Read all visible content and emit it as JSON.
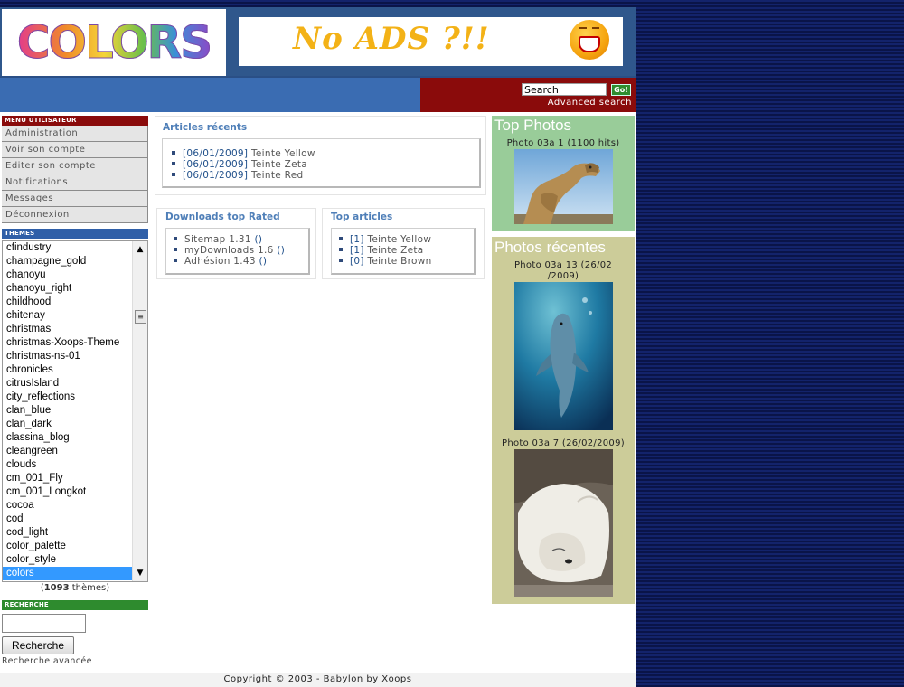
{
  "header": {
    "logo_text": "COLORS",
    "banner_text": "No ADS ?!!",
    "search": {
      "value": "Search",
      "go_label": "Go!",
      "advanced_link": "Advanced search"
    }
  },
  "user_menu": {
    "title": "MENU UTILISATEUR",
    "items": [
      "Administration",
      "Voir son compte",
      "Editer son compte",
      "Notifications",
      "Messages",
      "Déconnexion"
    ]
  },
  "themes": {
    "title": "THEMES",
    "options": [
      "cfindustry",
      "champagne_gold",
      "chanoyu",
      "chanoyu_right",
      "childhood",
      "chitenay",
      "christmas",
      "christmas-Xoops-Theme",
      "christmas-ns-01",
      "chronicles",
      "citrusIsland",
      "city_reflections",
      "clan_blue",
      "clan_dark",
      "classina_blog",
      "cleangreen",
      "clouds",
      "cm_001_Fly",
      "cm_001_Longkot",
      "cocoa",
      "cod",
      "cod_light",
      "color_palette",
      "color_style",
      "colors"
    ],
    "selected": "colors",
    "count_number": "1093",
    "count_suffix": " thèmes"
  },
  "search_block": {
    "title": "RECHERCHE",
    "input_value": "",
    "button_label": "Recherche",
    "advanced_link": "Recherche avancée"
  },
  "recent_articles": {
    "title": "Articles récents",
    "items": [
      {
        "date": "[06/01/2009]",
        "name": "Teinte Yellow"
      },
      {
        "date": "[06/01/2009]",
        "name": "Teinte Zeta"
      },
      {
        "date": "[06/01/2009]",
        "name": "Teinte Red"
      }
    ]
  },
  "downloads": {
    "title": "Downloads top Rated",
    "items": [
      {
        "name": "Sitemap 1.31",
        "count": "()"
      },
      {
        "name": "myDownloads 1.6",
        "count": "()"
      },
      {
        "name": "Adhésion 1.43",
        "count": "()"
      }
    ]
  },
  "top_articles": {
    "title": "Top articles",
    "items": [
      {
        "count": "[1]",
        "name": "Teinte Yellow"
      },
      {
        "count": "[1]",
        "name": "Teinte Zeta"
      },
      {
        "count": "[0]",
        "name": "Teinte Brown"
      }
    ]
  },
  "top_photos": {
    "title": "Top Photos",
    "caption_name": "Photo 03a 1",
    "caption_hits": "(1100 hits)"
  },
  "recent_photos": {
    "title": "Photos récentes",
    "photos": [
      {
        "caption_line1": "Photo 03a 13 (26/02",
        "caption_line2": "/2009)"
      },
      {
        "caption_line1": "Photo 03a 7 (26/02/2009)"
      }
    ]
  },
  "footer": {
    "text": "Copyright © 2003 - Babylon by Xoops"
  },
  "colors": {
    "header_blue": "#3a6cb2",
    "accent_red": "#8a0b0b",
    "top_photos_bg": "#99cc99",
    "recent_photos_bg": "#cccc99",
    "selected_blue": "#3399ff"
  }
}
